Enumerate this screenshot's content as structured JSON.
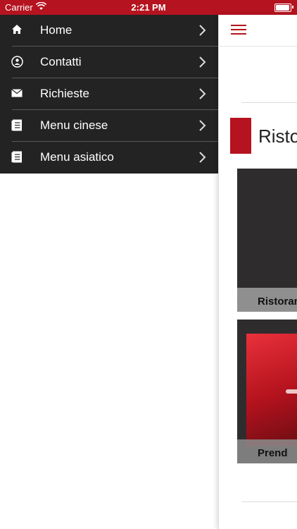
{
  "status_bar": {
    "carrier": "Carrier",
    "time": "2:21 PM"
  },
  "drawer": {
    "items": [
      {
        "label": "Home",
        "icon": "home-icon"
      },
      {
        "label": "Contatti",
        "icon": "contact-icon"
      },
      {
        "label": "Richieste",
        "icon": "mail-icon"
      },
      {
        "label": "Menu cinese",
        "icon": "document-icon"
      },
      {
        "label": "Menu asiatico",
        "icon": "document-icon"
      }
    ]
  },
  "main": {
    "section_title": "Risto",
    "cards": [
      {
        "caption": "Ristoran"
      },
      {
        "caption": "Prend"
      }
    ]
  },
  "colors": {
    "accent": "#b5131f",
    "drawer_bg": "#232323"
  }
}
